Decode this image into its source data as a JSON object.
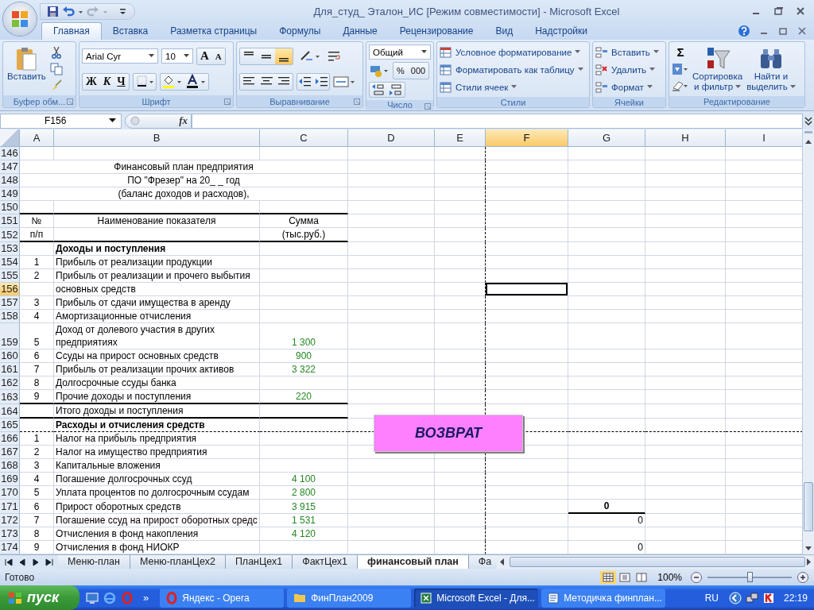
{
  "window": {
    "title": "Для_студ_ Эталон_ИС  [Режим совместимости] - Microsoft Excel"
  },
  "tabs": [
    {
      "label": "Главная",
      "selected": true
    },
    {
      "label": "Вставка",
      "selected": false
    },
    {
      "label": "Разметка страницы",
      "selected": false
    },
    {
      "label": "Формулы",
      "selected": false
    },
    {
      "label": "Данные",
      "selected": false
    },
    {
      "label": "Рецензирование",
      "selected": false
    },
    {
      "label": "Вид",
      "selected": false
    },
    {
      "label": "Надстройки",
      "selected": false
    }
  ],
  "ribbon": {
    "clipboard": {
      "label": "Буфер обм...",
      "paste": "Вставить"
    },
    "font": {
      "label": "Шрифт",
      "font_name": "Arial Cyr",
      "font_size": "10",
      "grow": "A",
      "shrink": "A",
      "bold": "Ж",
      "italic": "К",
      "underline": "Ч"
    },
    "alignment": {
      "label": "Выравнивание",
      "vertical": [
        {
          "selected": false
        },
        {
          "selected": false
        },
        {
          "selected": true
        }
      ]
    },
    "number": {
      "label": "Число",
      "format": "Общий",
      "percent": "%",
      "thousands": "000"
    },
    "styles": {
      "label": "Стили",
      "items": [
        "Условное форматирование",
        "Форматировать как таблицу",
        "Стили ячеек"
      ]
    },
    "cells": {
      "label": "Ячейки",
      "items": [
        "Вставить",
        "Удалить",
        "Формат"
      ]
    },
    "editing": {
      "label": "Редактирование",
      "sum": "Σ",
      "sort": [
        "Сортировка",
        "и фильтр"
      ],
      "find": [
        "Найти и",
        "выделить"
      ]
    }
  },
  "formula_bar": {
    "name_box": "F156",
    "fx": "fx"
  },
  "sheet": {
    "columns": [
      {
        "label": "A",
        "selected": false
      },
      {
        "label": "B",
        "selected": false
      },
      {
        "label": "C",
        "selected": false
      },
      {
        "label": "D",
        "selected": false
      },
      {
        "label": "E",
        "selected": false,
        "page_break": true
      },
      {
        "label": "F",
        "selected": true
      },
      {
        "label": "G",
        "selected": false
      },
      {
        "label": "H",
        "selected": false
      },
      {
        "label": "I",
        "selected": false
      }
    ],
    "rows": [
      {
        "row": "146",
        "kind": "blank",
        "selected": false
      },
      {
        "row": "147",
        "kind": "title",
        "text": "Финансовый план предприятия",
        "selected": false
      },
      {
        "row": "148",
        "kind": "title",
        "text": "ПО \"Фрезер\" на 20_ _ год",
        "selected": false
      },
      {
        "row": "149",
        "kind": "title",
        "text": "(баланс доходов и расходов),",
        "selected": false
      },
      {
        "row": "150",
        "kind": "blank",
        "selected": false,
        "rule_below": true
      },
      {
        "row": "151",
        "kind": "header",
        "a": "№",
        "b": "Наименование показателя",
        "c": "Сумма",
        "selected": false
      },
      {
        "row": "152",
        "kind": "header",
        "a": "п/п",
        "c": "(тыс.руб.)",
        "selected": false,
        "rule_below": true
      },
      {
        "row": "153",
        "kind": "section",
        "b": "Доходы и поступления",
        "selected": false
      },
      {
        "row": "154",
        "kind": "item",
        "a": "1",
        "b": "Прибыль от реализации продукции",
        "selected": false
      },
      {
        "row": "155",
        "kind": "item",
        "a": "2",
        "b": "Прибыль от реализации и прочего выбытия",
        "selected": false
      },
      {
        "row": "156",
        "kind": "item",
        "b": "основных средств",
        "selected": true
      },
      {
        "row": "157",
        "kind": "item",
        "a": "3",
        "b": "Прибыль от сдачи имущества в аренду",
        "selected": false
      },
      {
        "row": "158",
        "kind": "item",
        "a": "4",
        "b": "Амортизационные отчисления",
        "selected": false
      },
      {
        "row": "159",
        "kind": "item",
        "wrap": true,
        "a": "5",
        "b": "Доход от долевого участия в других предприятиях",
        "c": "1 300",
        "selected": false
      },
      {
        "row": "160",
        "kind": "item",
        "a": "6",
        "b": "Ссуды на прирост основных средств",
        "c": "900",
        "selected": false
      },
      {
        "row": "161",
        "kind": "item",
        "a": "7",
        "b": "Прибыль от реализации прочих активов",
        "c": "3 322",
        "selected": false
      },
      {
        "row": "162",
        "kind": "item",
        "a": "8",
        "b": "Долгосрочные ссуды банка",
        "selected": false
      },
      {
        "row": "163",
        "kind": "item",
        "a": "9",
        "b": "Прочие доходы и поступления",
        "c": "220",
        "selected": false,
        "rule_below": true
      },
      {
        "row": "164",
        "kind": "item",
        "b": "Итого доходы и поступления",
        "selected": false,
        "rule_below": true
      },
      {
        "row": "165",
        "kind": "section",
        "b": "Расходы и отчисления средств",
        "selected": false,
        "page_break": true
      },
      {
        "row": "166",
        "kind": "item",
        "a": "1",
        "b": "Налог на прибыль предприятия",
        "selected": false
      },
      {
        "row": "167",
        "kind": "item",
        "a": "2",
        "b": "Налог на имущество предприятия",
        "selected": false
      },
      {
        "row": "168",
        "kind": "item",
        "a": "3",
        "b": "Капитальные вложения",
        "selected": false
      },
      {
        "row": "169",
        "kind": "item",
        "a": "4",
        "b": "Погашение долгосрочных ссуд",
        "c": "4 100",
        "selected": false
      },
      {
        "row": "170",
        "kind": "item",
        "a": "5",
        "b": "Уплата процентов по долгосрочным ссудам",
        "c": "2 800",
        "selected": false
      },
      {
        "row": "171",
        "kind": "item",
        "a": "6",
        "b": "Прирост оборотных средств",
        "c": "3 915",
        "g": {
          "text": "0",
          "kind": "total"
        },
        "selected": false
      },
      {
        "row": "172",
        "kind": "item",
        "a": "7",
        "b": "Погашение ссуд на прирост оборотных средс",
        "c": "1 531",
        "g": {
          "text": "0",
          "kind": "value"
        },
        "selected": false
      },
      {
        "row": "173",
        "kind": "item",
        "a": "8",
        "b": "Отчисления в фонд накопления",
        "c": "4 120",
        "selected": false
      },
      {
        "row": "174",
        "kind": "item",
        "a": "9",
        "b": "Отчисления в фонд НИОКР",
        "g": {
          "text": "0",
          "kind": "value"
        },
        "selected": false
      }
    ],
    "button": "ВОЗВРАТ"
  },
  "sheet_tabs": [
    {
      "label": "Меню-план",
      "selected": false
    },
    {
      "label": "Меню-планЦех2",
      "selected": false
    },
    {
      "label": "ПланЦех1",
      "selected": false
    },
    {
      "label": "ФактЦех1",
      "selected": false
    },
    {
      "label": "финансовый план",
      "selected": true
    },
    {
      "label": "Фа",
      "selected": false
    }
  ],
  "status_bar": {
    "status": "Готово",
    "views": [
      {
        "selected": true
      },
      {
        "selected": false
      },
      {
        "selected": false
      }
    ],
    "zoom": "100%",
    "zoom_slider": {
      "level": 0.5
    }
  },
  "taskbar": {
    "start": "пуск",
    "chevron": "»",
    "items": [
      {
        "label": "Яндекс - Opera",
        "selected": false
      },
      {
        "label": "ФинПлан2009",
        "selected": false
      },
      {
        "label": "Microsoft Excel - Для...",
        "selected": true
      },
      {
        "label": "Методичка финплан...",
        "selected": false
      }
    ],
    "language": "RU",
    "clock": "22:19"
  }
}
